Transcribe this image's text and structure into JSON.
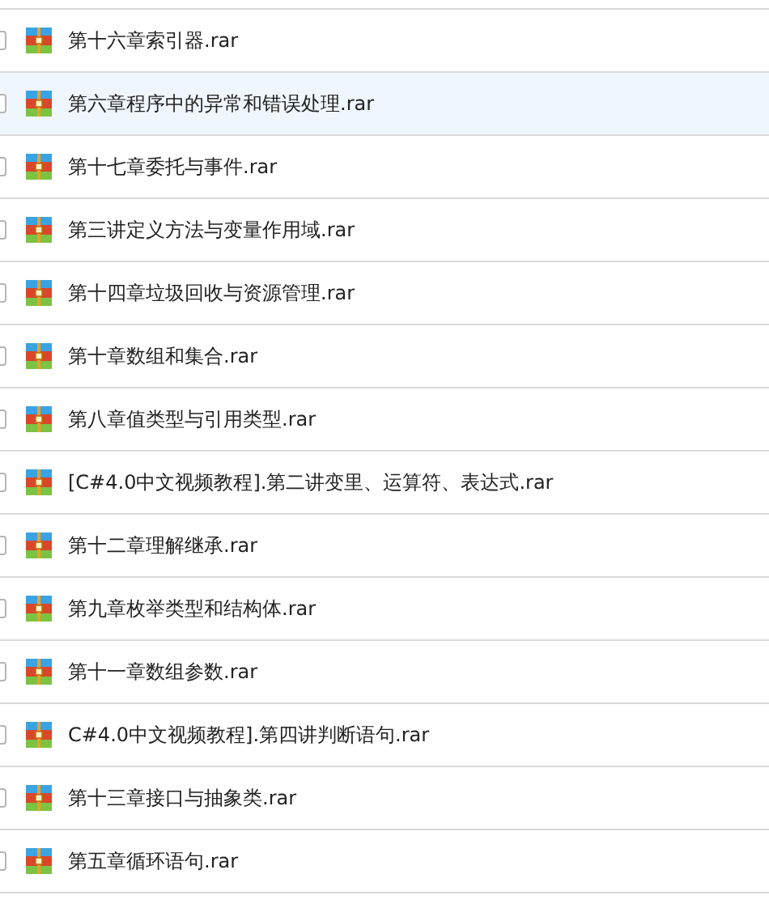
{
  "files": [
    {
      "name": "第十六章索引器.rar",
      "selected": false,
      "checked": false
    },
    {
      "name": "第六章程序中的异常和错误处理.rar",
      "selected": true,
      "checked": false
    },
    {
      "name": "第十七章委托与事件.rar",
      "selected": false,
      "checked": false
    },
    {
      "name": "第三讲定义方法与变量作用域.rar",
      "selected": false,
      "checked": false
    },
    {
      "name": "第十四章垃圾回收与资源管理.rar",
      "selected": false,
      "checked": false
    },
    {
      "name": "第十章数组和集合.rar",
      "selected": false,
      "checked": false
    },
    {
      "name": "第八章值类型与引用类型.rar",
      "selected": false,
      "checked": false
    },
    {
      "name": "[C#4.0中文视频教程].第二讲变里、运算符、表达式.rar",
      "selected": false,
      "checked": false
    },
    {
      "name": "第十二章理解继承.rar",
      "selected": false,
      "checked": false
    },
    {
      "name": "第九章枚举类型和结构体.rar",
      "selected": false,
      "checked": false
    },
    {
      "name": "第十一章数组参数.rar",
      "selected": false,
      "checked": false
    },
    {
      "name": "C#4.0中文视频教程].第四讲判断语句.rar",
      "selected": false,
      "checked": false
    },
    {
      "name": "第十三章接口与抽象类.rar",
      "selected": false,
      "checked": false
    },
    {
      "name": "第五章循环语句.rar",
      "selected": false,
      "checked": false
    }
  ]
}
